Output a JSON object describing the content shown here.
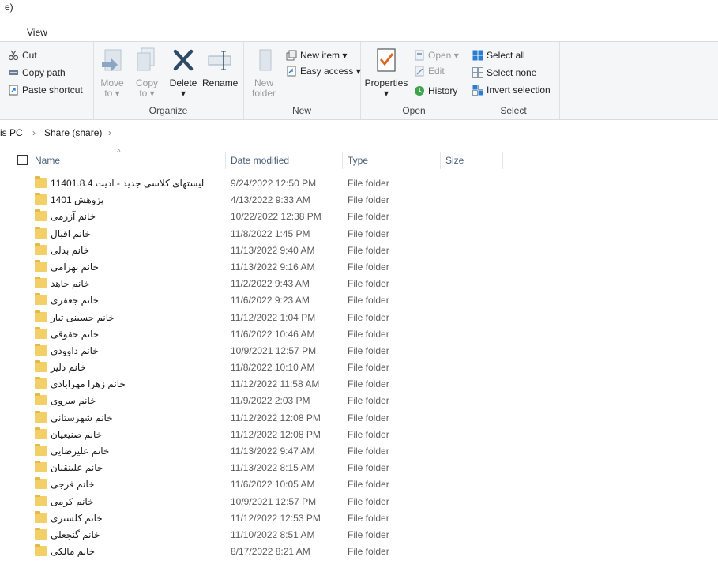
{
  "top_fragment": "e)",
  "tabs": {
    "view": "View"
  },
  "ribbon": {
    "clipboard": {
      "cut": "Cut",
      "copy_path": "Copy path",
      "paste_shortcut": "Paste shortcut"
    },
    "organize": {
      "label": "Organize",
      "move_to": [
        "Move",
        "to ▾"
      ],
      "copy_to": [
        "Copy",
        "to ▾"
      ],
      "delete": [
        "Delete",
        "▾"
      ],
      "rename": "Rename"
    },
    "new": {
      "label": "New",
      "new_folder": [
        "New",
        "folder"
      ],
      "new_item": "New item ▾",
      "easy_access": "Easy access ▾"
    },
    "open": {
      "label": "Open",
      "properties": [
        "Properties",
        "▾"
      ],
      "open": "Open ▾",
      "edit": "Edit",
      "history": "History"
    },
    "select": {
      "label": "Select",
      "select_all": "Select all",
      "select_none": "Select none",
      "invert": "Invert selection"
    }
  },
  "address": {
    "part1": "is PC",
    "sep1": "›",
    "part2": "Share (share)",
    "sep2": "›"
  },
  "columns": {
    "name": "Name",
    "date": "Date modified",
    "type": "Type",
    "size": "Size"
  },
  "files": [
    {
      "name": "1لیستهای کلاسی جدید - ادیت 1401.8.4",
      "date": "9/24/2022 12:50 PM",
      "type": "File folder"
    },
    {
      "name": "پژوهش 1401",
      "date": "4/13/2022 9:33 AM",
      "type": "File folder"
    },
    {
      "name": "خانم آزرمی",
      "date": "10/22/2022 12:38 PM",
      "type": "File folder"
    },
    {
      "name": "خانم اقبال",
      "date": "11/8/2022 1:45 PM",
      "type": "File folder"
    },
    {
      "name": "خانم بدلی",
      "date": "11/13/2022 9:40 AM",
      "type": "File folder"
    },
    {
      "name": "خانم بهرامی",
      "date": "11/13/2022 9:16 AM",
      "type": "File folder"
    },
    {
      "name": "خانم جاهد",
      "date": "11/2/2022 9:43 AM",
      "type": "File folder"
    },
    {
      "name": "خانم جعفری",
      "date": "11/6/2022 9:23 AM",
      "type": "File folder"
    },
    {
      "name": "خانم حسینی تبار",
      "date": "11/12/2022 1:04 PM",
      "type": "File folder"
    },
    {
      "name": "خانم حقوقی",
      "date": "11/6/2022 10:46 AM",
      "type": "File folder"
    },
    {
      "name": "خانم داوودی",
      "date": "10/9/2021 12:57 PM",
      "type": "File folder"
    },
    {
      "name": "خانم دلیر",
      "date": "11/8/2022 10:10 AM",
      "type": "File folder"
    },
    {
      "name": "خانم زهرا مهرابادی",
      "date": "11/12/2022 11:58 AM",
      "type": "File folder"
    },
    {
      "name": "خانم سروی",
      "date": "11/9/2022 2:03 PM",
      "type": "File folder"
    },
    {
      "name": "خانم شهرستانی",
      "date": "11/12/2022 12:08 PM",
      "type": "File folder"
    },
    {
      "name": "خانم صنیعیان",
      "date": "11/12/2022 12:08 PM",
      "type": "File folder"
    },
    {
      "name": "خانم علیرضایی",
      "date": "11/13/2022 9:47 AM",
      "type": "File folder"
    },
    {
      "name": "خانم علینقیان",
      "date": "11/13/2022 8:15 AM",
      "type": "File folder"
    },
    {
      "name": "خانم فرجی",
      "date": "11/6/2022 10:05 AM",
      "type": "File folder"
    },
    {
      "name": "خانم کرمی",
      "date": "10/9/2021 12:57 PM",
      "type": "File folder"
    },
    {
      "name": "خانم کلشتری",
      "date": "11/12/2022 12:53 PM",
      "type": "File folder"
    },
    {
      "name": "خانم گنجعلی",
      "date": "11/10/2022 8:51 AM",
      "type": "File folder"
    },
    {
      "name": "خانم مالکی",
      "date": "8/17/2022 8:21 AM",
      "type": "File folder"
    }
  ],
  "colors": {
    "folder": "#f3cf67",
    "header_text": "#4c607a",
    "select_blue": "#2b7cd3"
  }
}
